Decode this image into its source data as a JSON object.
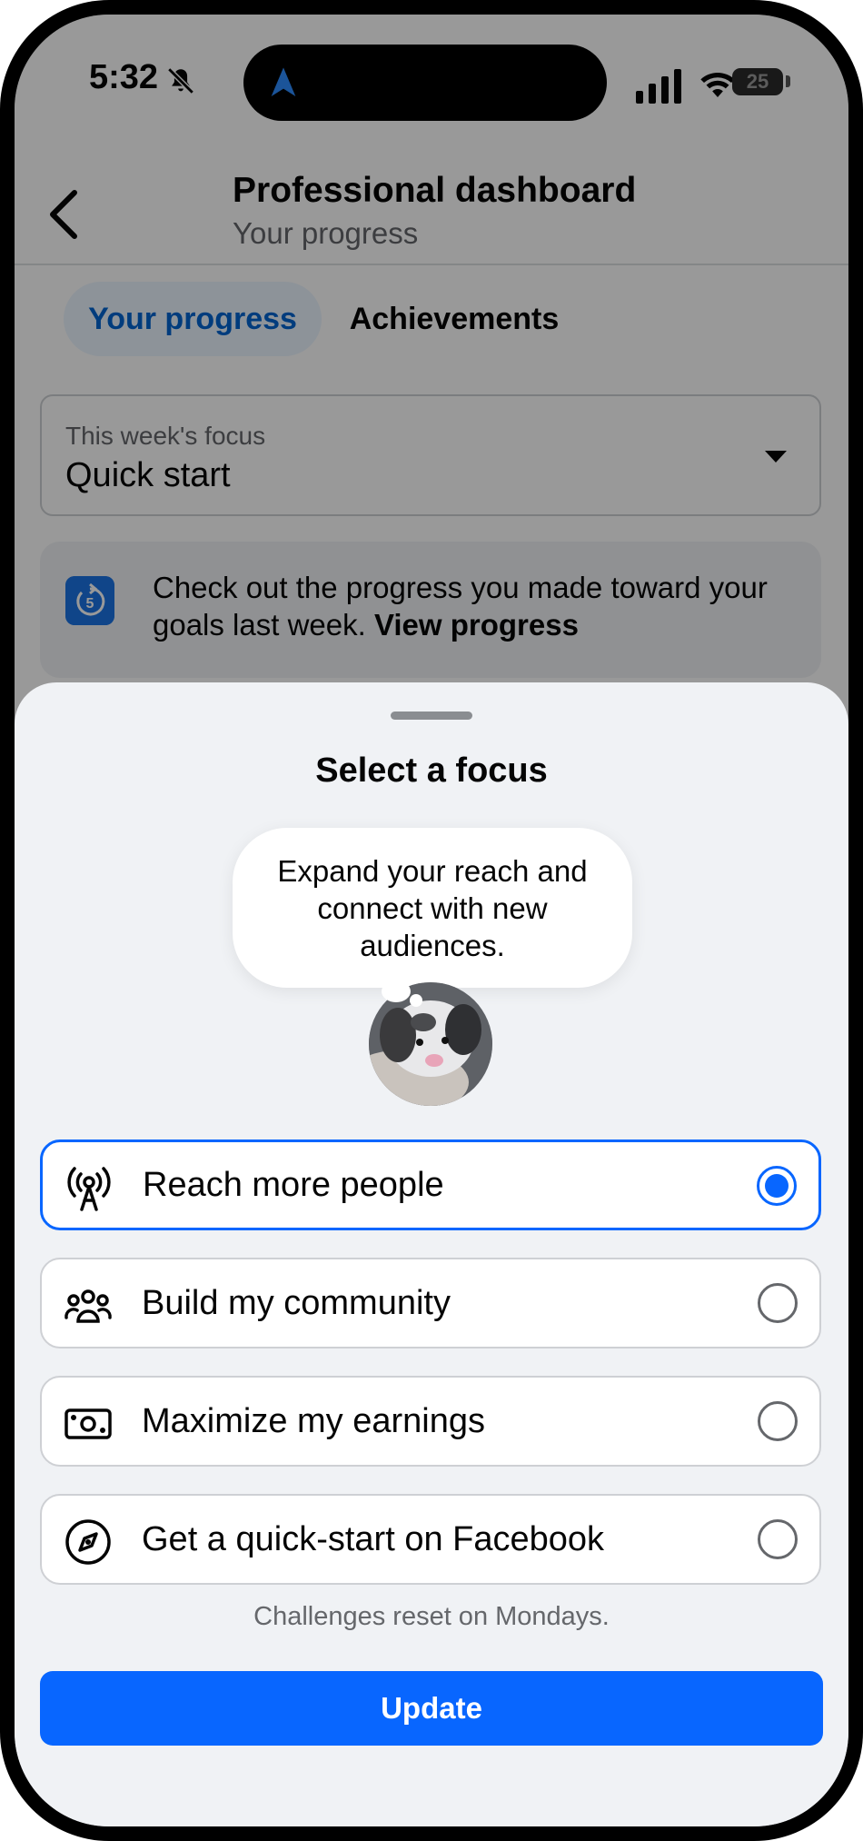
{
  "status_bar": {
    "time": "5:32",
    "battery": "25"
  },
  "header": {
    "title": "Professional dashboard",
    "subtitle": "Your progress"
  },
  "tabs": [
    {
      "label": "Your progress",
      "active": true
    },
    {
      "label": "Achievements",
      "active": false
    }
  ],
  "focus_select": {
    "label": "This week's focus",
    "value": "Quick start"
  },
  "progress_card": {
    "text": "Check out the progress you made toward your goals last week.",
    "link": "View progress"
  },
  "sheet": {
    "title": "Select a focus",
    "bubble_text": "Expand your reach and connect with new audiences.",
    "options": [
      {
        "label": "Reach more people",
        "icon": "broadcast-tower-icon",
        "selected": true
      },
      {
        "label": "Build my community",
        "icon": "people-group-icon",
        "selected": false
      },
      {
        "label": "Maximize my earnings",
        "icon": "money-bill-icon",
        "selected": false
      },
      {
        "label": "Get a quick-start on Facebook",
        "icon": "compass-icon",
        "selected": false
      }
    ],
    "note": "Challenges reset on Mondays.",
    "update_label": "Update"
  },
  "colors": {
    "accent": "#0866ff",
    "tab_active_text": "#0064d1",
    "sheet_bg": "#f0f2f5"
  }
}
